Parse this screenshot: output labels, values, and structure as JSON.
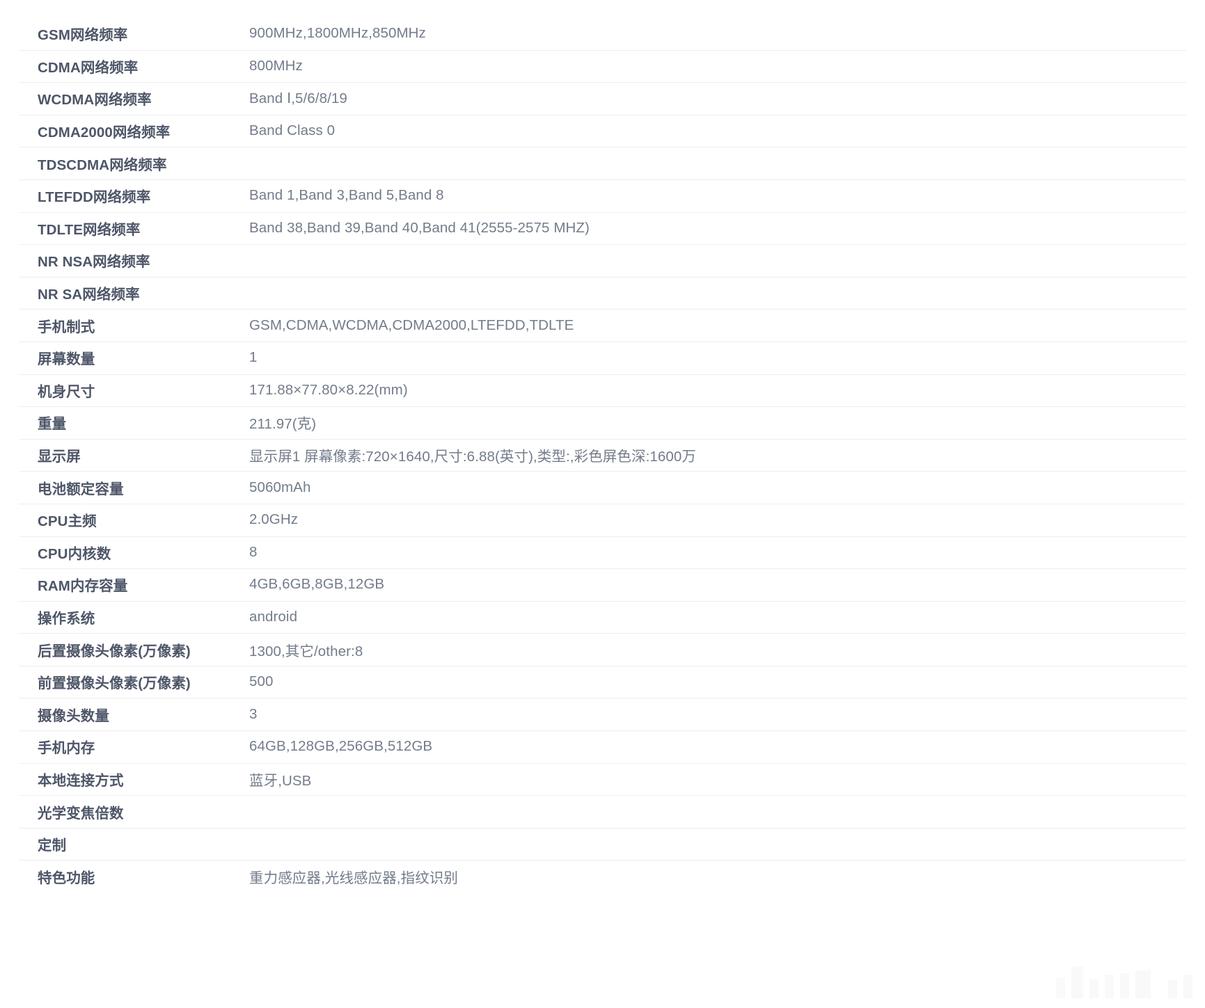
{
  "page": {
    "type": "device-specification-table",
    "background_color": "#ffffff",
    "label_color": "#4e5668",
    "value_color": "#737c8b",
    "divider_color": "#eceef1"
  },
  "table": {
    "rows": [
      {
        "label": "GSM网络频率",
        "value": "900MHz,1800MHz,850MHz"
      },
      {
        "label": "CDMA网络频率",
        "value": "800MHz"
      },
      {
        "label": "WCDMA网络频率",
        "value": "Band Ⅰ,5/6/8/19"
      },
      {
        "label": "CDMA2000网络频率",
        "value": "Band Class 0"
      },
      {
        "label": "TDSCDMA网络频率",
        "value": ""
      },
      {
        "label": "LTEFDD网络频率",
        "value": "Band 1,Band 3,Band 5,Band 8"
      },
      {
        "label": "TDLTE网络频率",
        "value": "Band 38,Band 39,Band 40,Band 41(2555-2575 MHZ)"
      },
      {
        "label": "NR NSA网络频率",
        "value": ""
      },
      {
        "label": "NR SA网络频率",
        "value": ""
      },
      {
        "label": "手机制式",
        "value": "GSM,CDMA,WCDMA,CDMA2000,LTEFDD,TDLTE"
      },
      {
        "label": "屏幕数量",
        "value": "1"
      },
      {
        "label": "机身尺寸",
        "value": "171.88×77.80×8.22(mm)"
      },
      {
        "label": "重量",
        "value": "211.97(克)"
      },
      {
        "label": "显示屏",
        "value": "显示屏1 屏幕像素:720×1640,尺寸:6.88(英寸),类型:,彩色屏色深:1600万"
      },
      {
        "label": "电池额定容量",
        "value": "5060mAh"
      },
      {
        "label": "CPU主频",
        "value": "2.0GHz"
      },
      {
        "label": "CPU内核数",
        "value": "8"
      },
      {
        "label": "RAM内存容量",
        "value": "4GB,6GB,8GB,12GB"
      },
      {
        "label": "操作系统",
        "value": "android"
      },
      {
        "label": "后置摄像头像素(万像素)",
        "value": "1300,其它/other:8"
      },
      {
        "label": "前置摄像头像素(万像素)",
        "value": "500"
      },
      {
        "label": "摄像头数量",
        "value": "3"
      },
      {
        "label": "手机内存",
        "value": "64GB,128GB,256GB,512GB"
      },
      {
        "label": "本地连接方式",
        "value": "蓝牙,USB"
      },
      {
        "label": "光学变焦倍数",
        "value": ""
      },
      {
        "label": "定制",
        "value": ""
      },
      {
        "label": "特色功能",
        "value": "重力感应器,光线感应器,指纹识别"
      }
    ]
  },
  "watermark": {
    "name": "watermark-logo",
    "color": "#f4f5f6"
  }
}
